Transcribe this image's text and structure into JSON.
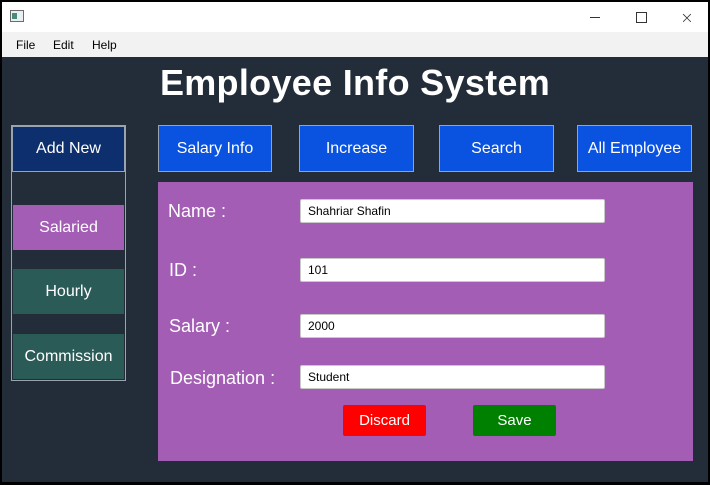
{
  "window": {
    "controls": {
      "minimize": "minimize",
      "maximize": "maximize",
      "close": "×"
    }
  },
  "menu": {
    "items": [
      "File",
      "Edit",
      "Help"
    ]
  },
  "header": {
    "title": "Employee Info System"
  },
  "sidebar": {
    "add_new": "Add New",
    "items": [
      "Salaried",
      "Hourly",
      "Commission"
    ]
  },
  "toolbar": {
    "buttons": [
      "Salary Info",
      "Increase",
      "Search",
      "All Employee"
    ]
  },
  "form": {
    "name_label": "Name :",
    "name_value": "Shahriar Shafin",
    "id_label": "ID :",
    "id_value": "101",
    "salary_label": "Salary :",
    "salary_value": "2000",
    "designation_label": "Designation :",
    "designation_value": "Student",
    "discard_label": "Discard",
    "save_label": "Save"
  },
  "colors": {
    "background": "#232d3a",
    "panel": "#a35db4",
    "primary_button": "#0a52e0",
    "add_new": "#0d2f6e",
    "secondary_button": "#2b5b57",
    "discard": "#ff0000",
    "save": "#008000"
  }
}
